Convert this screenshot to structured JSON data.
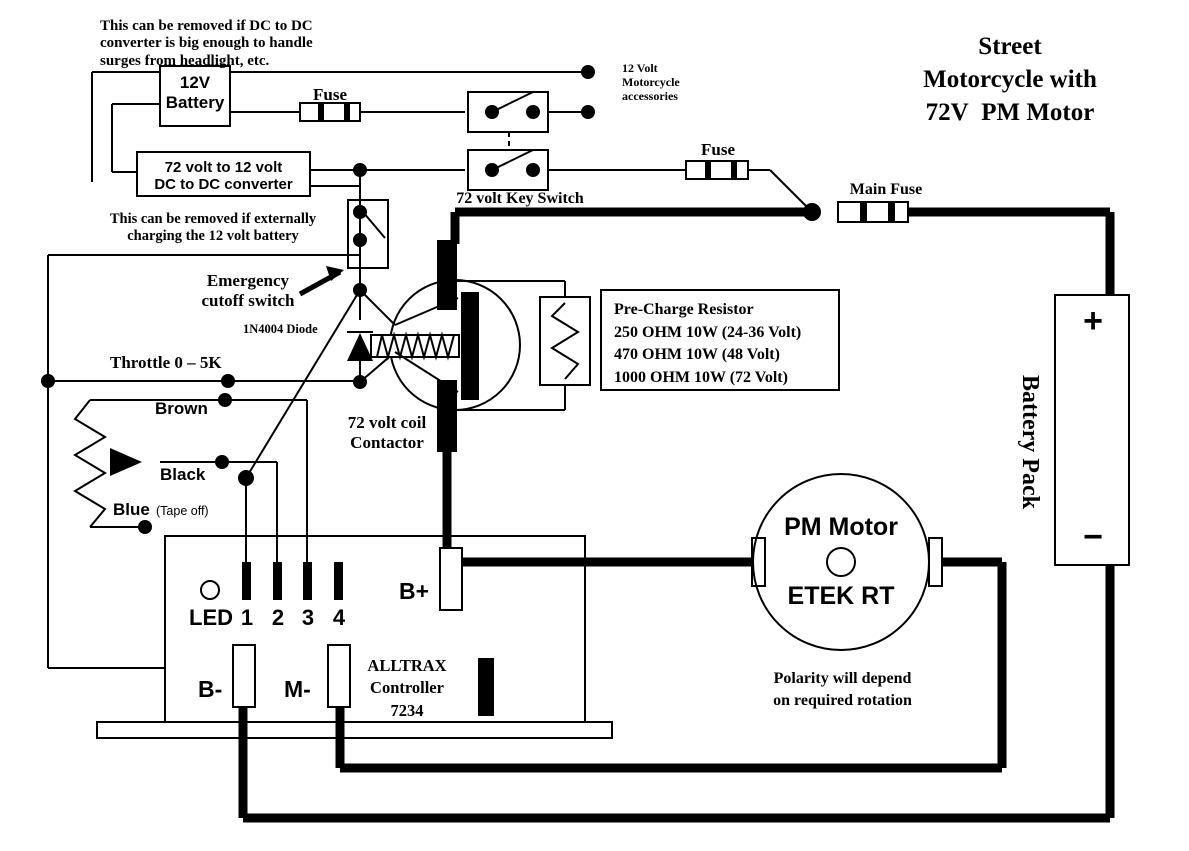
{
  "title": {
    "line1": "Street",
    "line2": "Motorcycle with",
    "line3a": "72V",
    "line3b": "PM Motor"
  },
  "notes": {
    "dcdc_removable": "This can be removed if DC to DC\nconverter is big enough to handle\nsurges from headlight, etc.",
    "battery_removable": "This can be removed if externally\ncharging the 12 volt battery",
    "polarity": "Polarity will depend\non required rotation"
  },
  "components": {
    "battery12v": "12V\nBattery",
    "dcdc_converter": "72 volt to 12 volt\nDC to DC converter",
    "fuse_12v": "Fuse",
    "fuse_key": "Fuse",
    "main_fuse": "Main Fuse",
    "accessories": "12 Volt\nMotorcycle\naccessories",
    "key_switch": "72 volt Key Switch",
    "emergency_cutoff": "Emergency\ncutoff switch",
    "diode": "1N4004 Diode",
    "contactor": "72 volt coil\nContactor",
    "throttle": "Throttle 0 – 5K",
    "wire_brown": "Brown",
    "wire_black": "Black",
    "wire_blue": "Blue",
    "wire_blue_note": "(Tape off)",
    "led": "LED",
    "pin1": "1",
    "pin2": "2",
    "pin3": "3",
    "pin4": "4",
    "bplus": "B+",
    "bminus": "B-",
    "mminus": "M-",
    "controller_brand": "ALLTRAX",
    "controller_word": "Controller",
    "controller_model": "7234",
    "motor_line1": "PM Motor",
    "motor_line2": "ETEK RT",
    "battery_pack": "Battery Pack",
    "battery_plus": "+",
    "battery_minus": "−"
  },
  "precharge": {
    "title": "Pre-Charge Resistor",
    "row1": "250 OHM 10W (24-36 Volt)",
    "row2": "470 OHM 10W (48 Volt)",
    "row3": "1000 OHM 10W (72 Volt)"
  },
  "colors": {
    "ink": "#000000",
    "background": "#ffffff"
  }
}
